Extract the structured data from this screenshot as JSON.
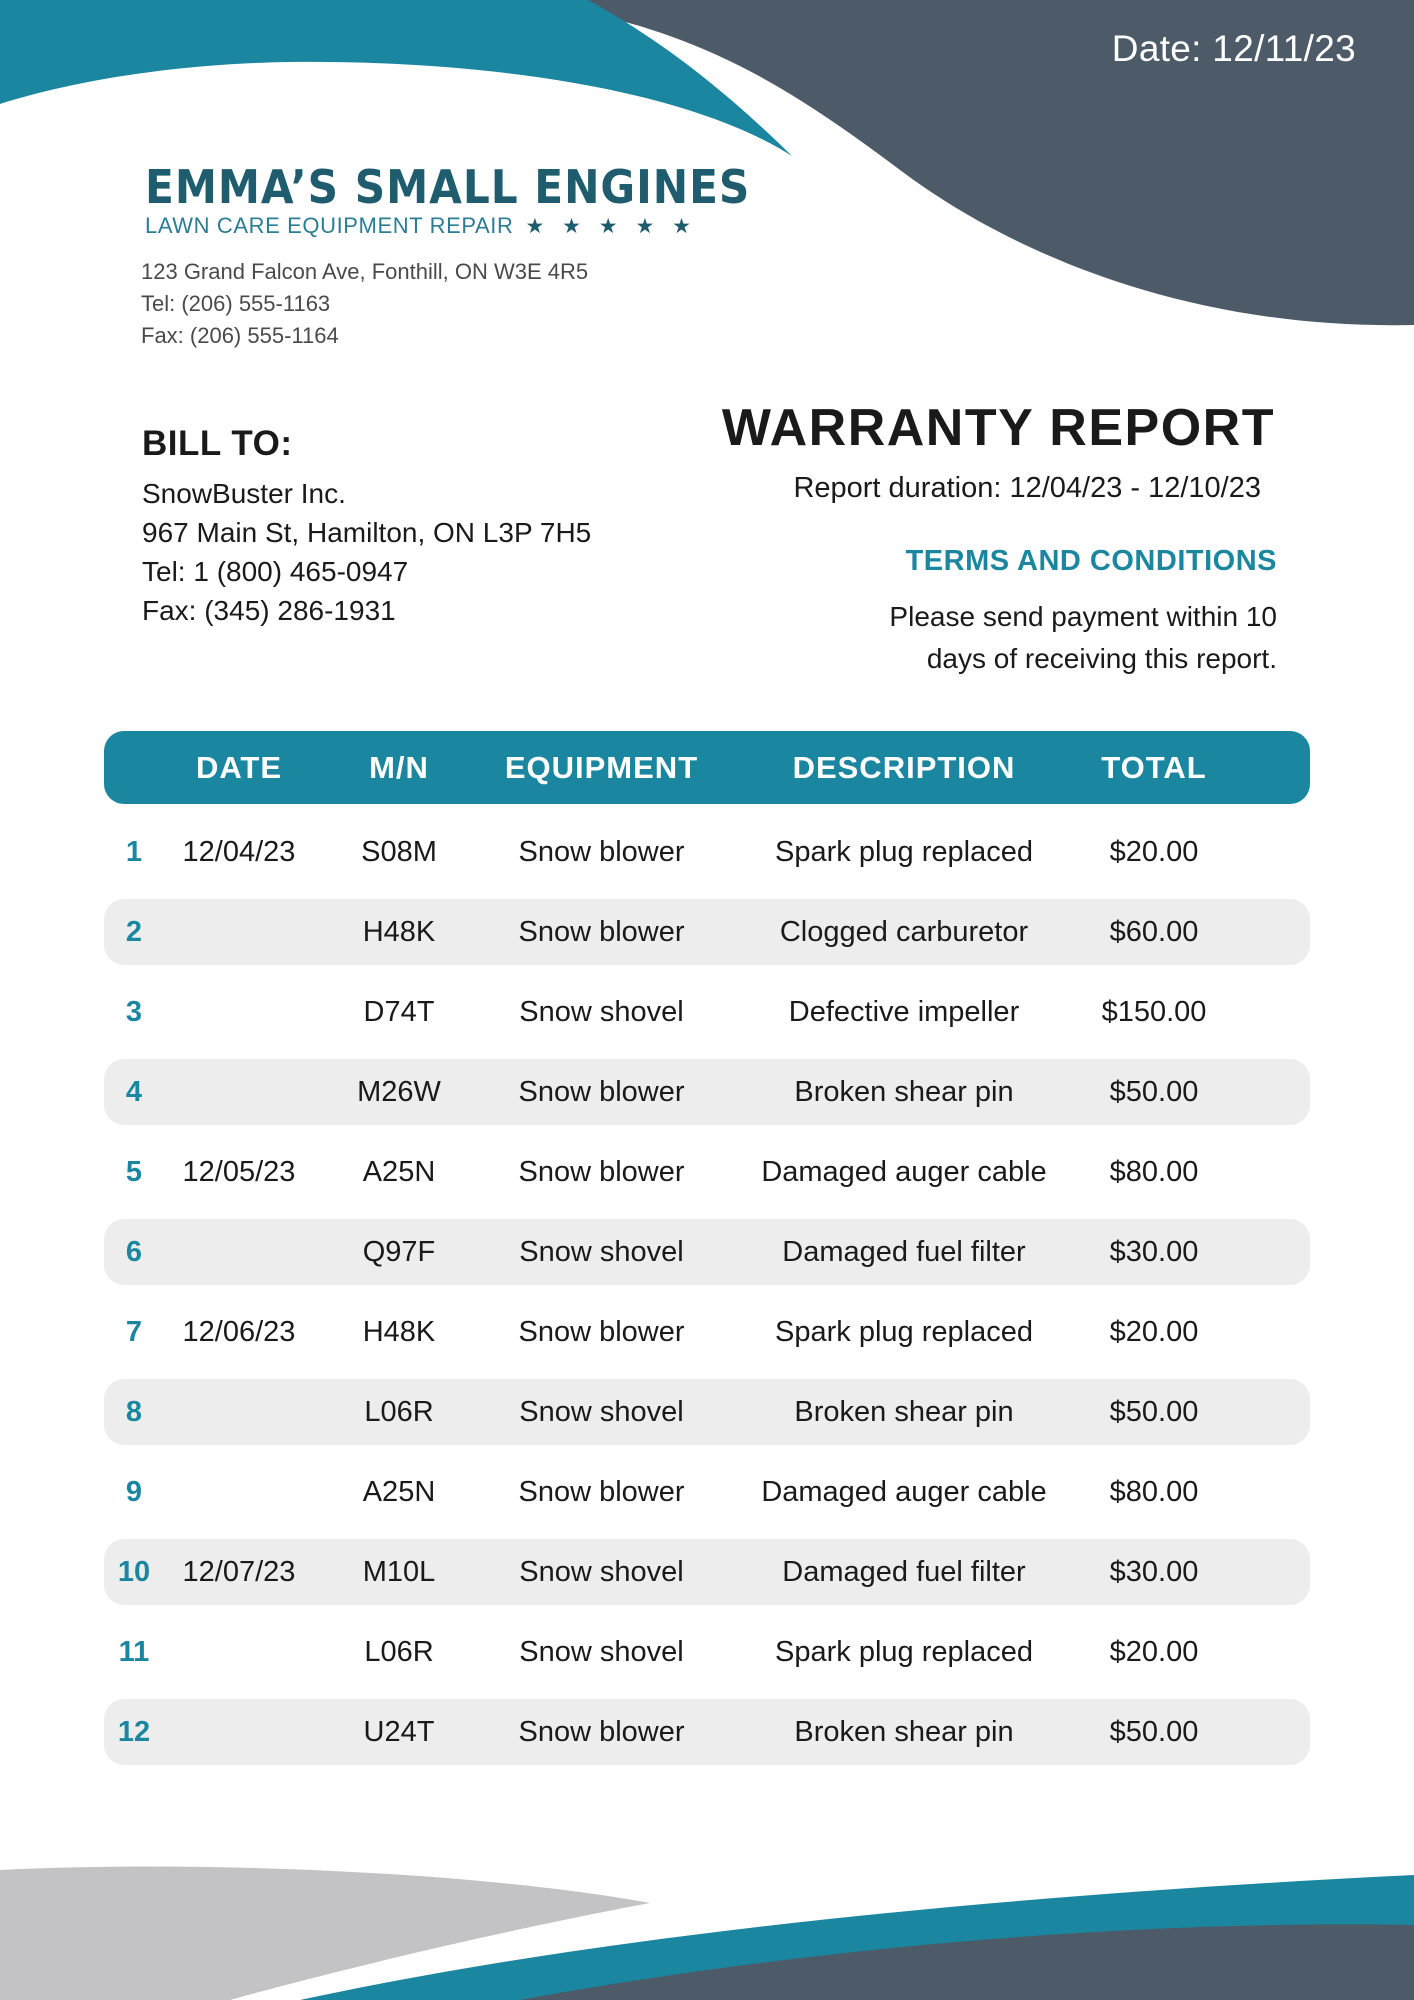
{
  "header": {
    "date": "Date: 12/11/23"
  },
  "company": {
    "name": "EMMA’S SMALL ENGINES",
    "tagline": "LAWN CARE EQUIPMENT REPAIR",
    "stars": "★ ★ ★ ★ ★",
    "address": "123 Grand Falcon Ave, Fonthill, ON W3E 4R5",
    "tel": "Tel: (206) 555-1163",
    "fax": "Fax: (206) 555-1164"
  },
  "bill_to": {
    "heading": "BILL TO:",
    "name": "SnowBuster Inc.",
    "address": "967 Main St, Hamilton, ON L3P 7H5",
    "tel": "Tel: 1 (800) 465-0947",
    "fax": "Fax: (345) 286-1931"
  },
  "report": {
    "title": "WARRANTY REPORT",
    "duration": "Report duration: 12/04/23 - 12/10/23",
    "terms_heading": "TERMS AND CONDITIONS",
    "terms_line1": "Please send payment within 10",
    "terms_line2": "days of receiving this report."
  },
  "table": {
    "headers": {
      "date": "DATE",
      "mn": "M/N",
      "equipment": "EQUIPMENT",
      "description": "DESCRIPTION",
      "total": "TOTAL"
    },
    "rows": [
      {
        "num": "1",
        "date": "12/04/23",
        "mn": "S08M",
        "equipment": "Snow blower",
        "description": "Spark plug replaced",
        "total": "$20.00"
      },
      {
        "num": "2",
        "date": "",
        "mn": "H48K",
        "equipment": "Snow blower",
        "description": "Clogged carburetor",
        "total": "$60.00"
      },
      {
        "num": "3",
        "date": "",
        "mn": "D74T",
        "equipment": "Snow shovel",
        "description": "Defective impeller",
        "total": "$150.00"
      },
      {
        "num": "4",
        "date": "",
        "mn": "M26W",
        "equipment": "Snow blower",
        "description": "Broken shear pin",
        "total": "$50.00"
      },
      {
        "num": "5",
        "date": "12/05/23",
        "mn": "A25N",
        "equipment": "Snow blower",
        "description": "Damaged auger cable",
        "total": "$80.00"
      },
      {
        "num": "6",
        "date": "",
        "mn": "Q97F",
        "equipment": "Snow shovel",
        "description": "Damaged fuel filter",
        "total": "$30.00"
      },
      {
        "num": "7",
        "date": "12/06/23",
        "mn": "H48K",
        "equipment": "Snow blower",
        "description": "Spark plug replaced",
        "total": "$20.00"
      },
      {
        "num": "8",
        "date": "",
        "mn": "L06R",
        "equipment": "Snow shovel",
        "description": "Broken shear pin",
        "total": "$50.00"
      },
      {
        "num": "9",
        "date": "",
        "mn": "A25N",
        "equipment": "Snow blower",
        "description": "Damaged auger cable",
        "total": "$80.00"
      },
      {
        "num": "10",
        "date": "12/07/23",
        "mn": "M10L",
        "equipment": "Snow shovel",
        "description": "Damaged fuel filter",
        "total": "$30.00"
      },
      {
        "num": "11",
        "date": "",
        "mn": "L06R",
        "equipment": "Snow shovel",
        "description": "Spark plug replaced",
        "total": "$20.00"
      },
      {
        "num": "12",
        "date": "",
        "mn": "U24T",
        "equipment": "Snow blower",
        "description": "Broken shear pin",
        "total": "$50.00"
      }
    ]
  },
  "colors": {
    "teal": "#1b869f",
    "slate": "#4d5b69",
    "light_gray": "#c3c3c6",
    "row_alt": "#ededed"
  }
}
